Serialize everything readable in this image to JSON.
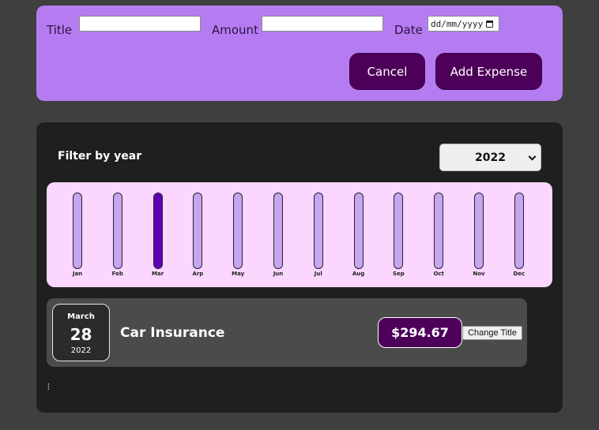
{
  "form": {
    "title_label": "Title",
    "title_value": "",
    "amount_label": "Amount",
    "amount_value": "",
    "date_label": "Date",
    "date_placeholder": "dd/mm/yyyy",
    "cancel_label": "Cancel",
    "submit_label": "Add Expense"
  },
  "filter": {
    "label": "Filter by year",
    "selected_year": "2022"
  },
  "chart_data": {
    "type": "bar",
    "categories": [
      "Jan",
      "Feb",
      "Mar",
      "Arp",
      "May",
      "Jun",
      "Jul",
      "Aug",
      "Sep",
      "Oct",
      "Nov",
      "Dec"
    ],
    "values": [
      0,
      0,
      294.67,
      0,
      0,
      0,
      0,
      0,
      0,
      0,
      0,
      0
    ],
    "max": 294.67
  },
  "expenses": [
    {
      "month": "March",
      "day": "28",
      "year": "2022",
      "title": "Car Insurance",
      "amount": "$294.67",
      "change_label": "Change Title"
    }
  ],
  "colors": {
    "form_bg": "#b57cf2",
    "button_bg": "#4d005a",
    "chart_bg": "#fbd6ff",
    "bar_fill": "#5c00b0",
    "bar_track": "#c4a7ee"
  }
}
